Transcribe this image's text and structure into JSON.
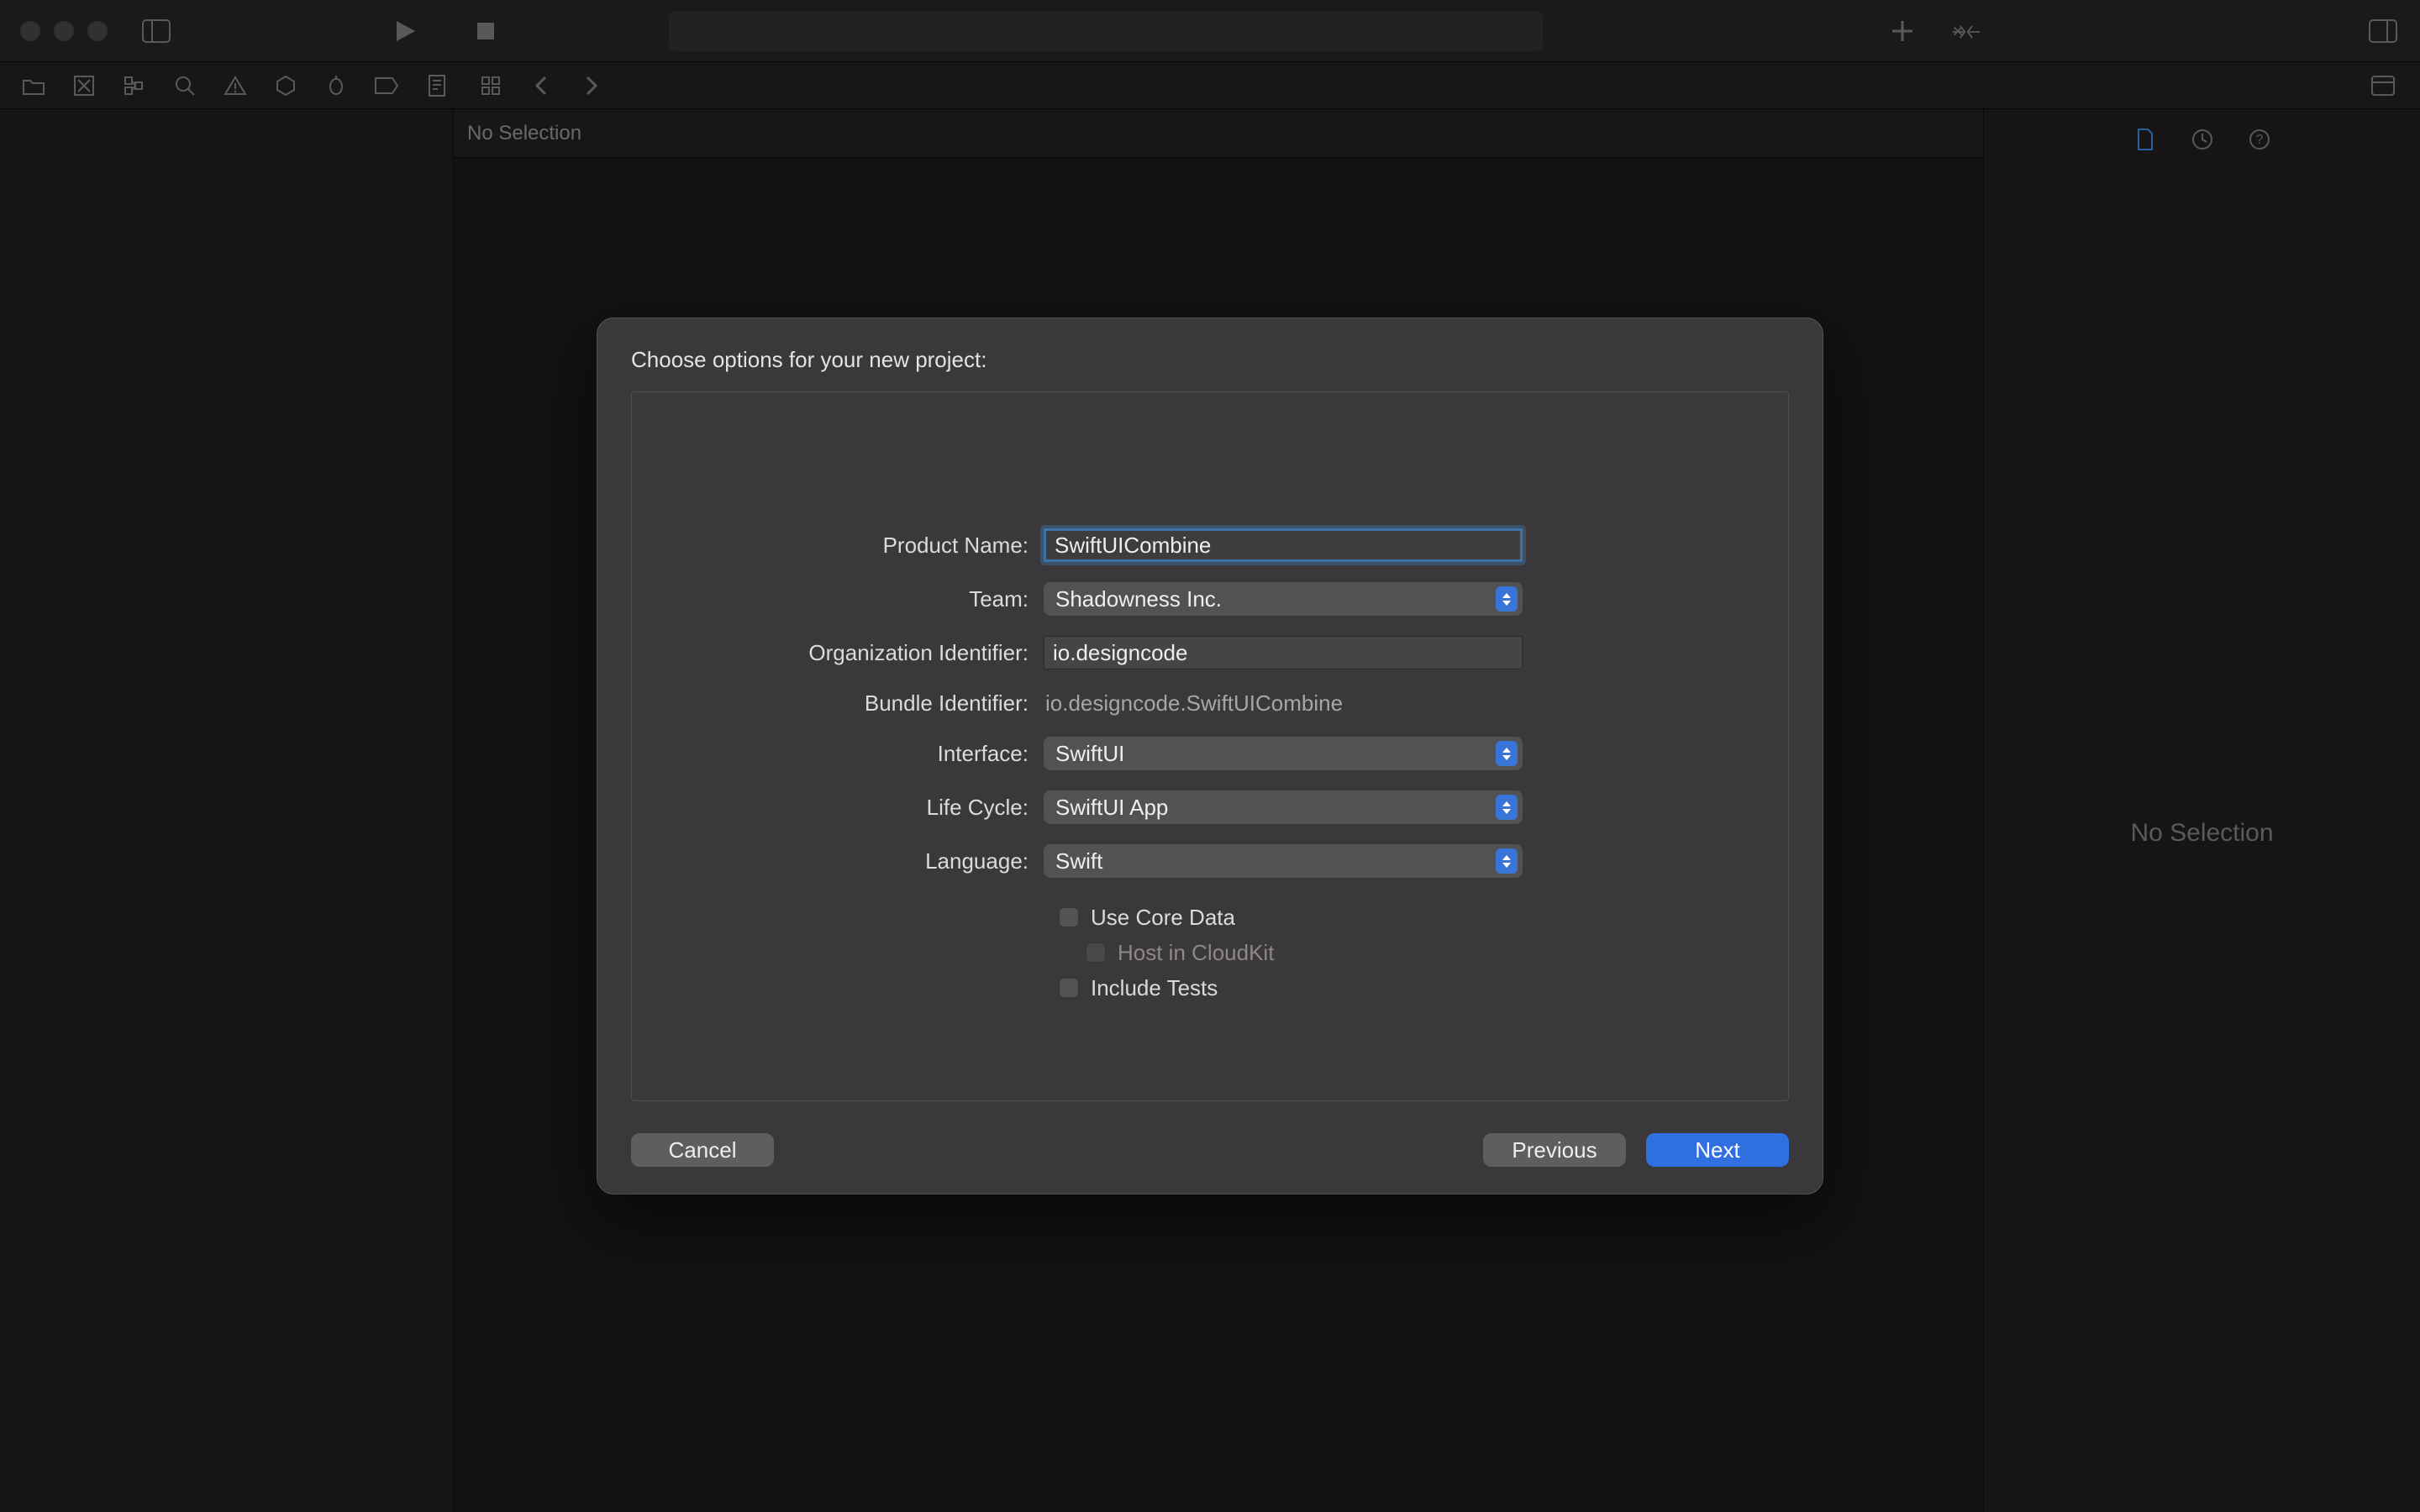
{
  "editor_tabbar": {
    "text": "No Selection"
  },
  "inspector": {
    "empty_text": "No Selection"
  },
  "dialog": {
    "title": "Choose options for your new project:",
    "labels": {
      "product_name": "Product Name:",
      "team": "Team:",
      "org_id": "Organization Identifier:",
      "bundle_id": "Bundle Identifier:",
      "interface": "Interface:",
      "life_cycle": "Life Cycle:",
      "language": "Language:"
    },
    "values": {
      "product_name": "SwiftUICombine",
      "team": "Shadowness Inc.",
      "org_id": "io.designcode",
      "bundle_id": "io.designcode.SwiftUICombine",
      "interface": "SwiftUI",
      "life_cycle": "SwiftUI App",
      "language": "Swift"
    },
    "checks": {
      "core_data": "Use Core Data",
      "cloudkit": "Host in CloudKit",
      "include_tests": "Include Tests"
    },
    "buttons": {
      "cancel": "Cancel",
      "previous": "Previous",
      "next": "Next"
    }
  }
}
